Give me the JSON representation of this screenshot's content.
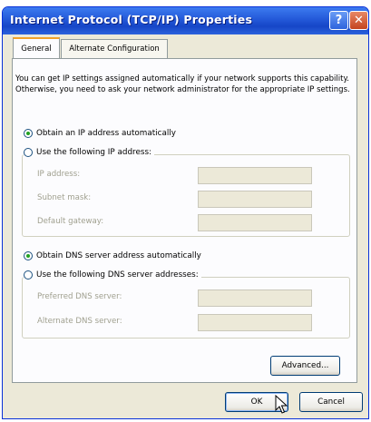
{
  "window": {
    "title": "Internet Protocol (TCP/IP) Properties",
    "help_glyph": "?",
    "close_glyph": "✕"
  },
  "tabs": [
    {
      "label": "General",
      "selected": true
    },
    {
      "label": "Alternate Configuration",
      "selected": false
    }
  ],
  "description": "You can get IP settings assigned automatically if your network supports this capability. Otherwise, you need to ask your network administrator for the appropriate IP settings.",
  "ip_section": {
    "auto_label": "Obtain an IP address automatically",
    "auto_selected": true,
    "manual_label": "Use the following IP address:",
    "fields": [
      {
        "label": "IP address:",
        "value": ""
      },
      {
        "label": "Subnet mask:",
        "value": ""
      },
      {
        "label": "Default gateway:",
        "value": ""
      }
    ]
  },
  "dns_section": {
    "auto_label": "Obtain DNS server address automatically",
    "auto_selected": true,
    "manual_label": "Use the following DNS server addresses:",
    "fields": [
      {
        "label": "Preferred DNS server:",
        "value": ""
      },
      {
        "label": "Alternate DNS server:",
        "value": ""
      }
    ]
  },
  "buttons": {
    "advanced": "Advanced...",
    "ok": "OK",
    "cancel": "Cancel"
  },
  "colors": {
    "titlebar": "#2358d8",
    "dialog_bg": "#ece9d8",
    "radio_dot": "#21a121",
    "tab_highlight": "#f2a128"
  },
  "icons": {
    "help": "help-icon",
    "close": "close-icon",
    "cursor": "mouse-pointer-icon"
  }
}
